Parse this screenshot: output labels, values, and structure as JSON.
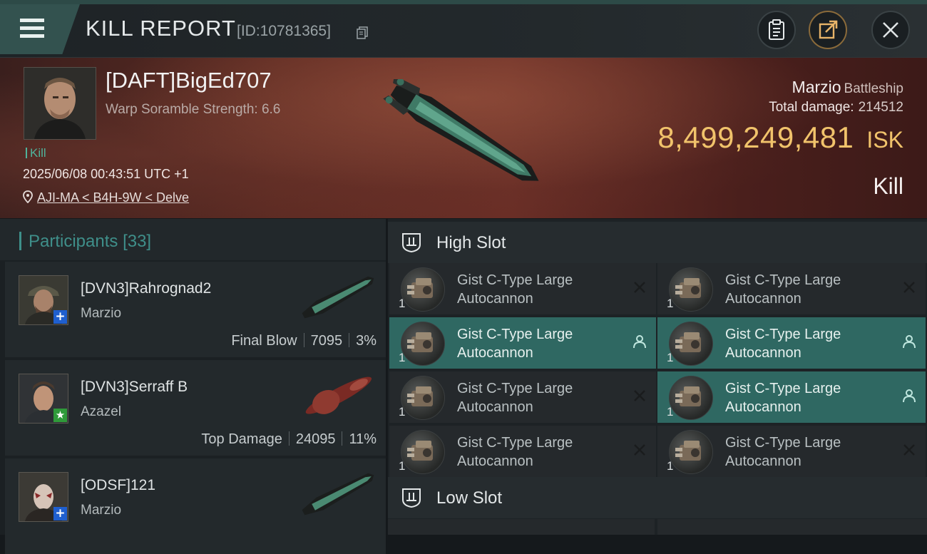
{
  "window": {
    "title": "KILL REPORT",
    "id_label": "[ID:10781365]"
  },
  "victim": {
    "name": "[DAFT]BigEd707",
    "subtitle": "Warp Soramble Strength: 6.6",
    "tag": "Kill",
    "datetime": "2025/06/08 00:43:51 UTC +1",
    "location": "AJI-MA < B4H-9W < Delve",
    "ship_name": "Marzio",
    "ship_class": "Battleship",
    "total_damage_label": "Total damage:",
    "total_damage": "214512",
    "isk_value": "8,499,249,481",
    "isk_unit": "ISK",
    "result": "Kill"
  },
  "participants": {
    "label": "Participants",
    "count": "[33]",
    "rows": [
      {
        "name": "[DVN3]Rahrognad2",
        "ship": "Marzio",
        "stat_label": "Final Blow",
        "damage": "7095",
        "percent": "3%",
        "badge": "+",
        "badge_color": "#1f5fcf"
      },
      {
        "name": "[DVN3]Serraff B",
        "ship": "Azazel",
        "stat_label": "Top Damage",
        "damage": "24095",
        "percent": "11%",
        "badge": "★",
        "badge_color": "#2f9a3a"
      },
      {
        "name": "[ODSF]121",
        "ship": "Marzio",
        "badge": "+",
        "badge_color": "#1f5fcf"
      }
    ]
  },
  "slots": {
    "high_label": "High Slot",
    "low_label": "Low Slot",
    "high_modules": [
      {
        "line1": "Gist C-Type Large",
        "line2": "Autocannon",
        "qty": "1",
        "state": "destroyed"
      },
      {
        "line1": "Gist C-Type Large",
        "line2": "Autocannon",
        "qty": "1",
        "state": "destroyed"
      },
      {
        "line1": "Gist C-Type Large",
        "line2": "Autocannon",
        "qty": "1",
        "state": "dropped"
      },
      {
        "line1": "Gist C-Type Large",
        "line2": "Autocannon",
        "qty": "1",
        "state": "dropped"
      },
      {
        "line1": "Gist C-Type Large",
        "line2": "Autocannon",
        "qty": "1",
        "state": "destroyed"
      },
      {
        "line1": "Gist C-Type Large",
        "line2": "Autocannon",
        "qty": "1",
        "state": "dropped"
      },
      {
        "line1": "Gist C-Type Large",
        "line2": "Autocannon",
        "qty": "1",
        "state": "destroyed"
      },
      {
        "line1": "Gist C-Type Large",
        "line2": "Autocannon",
        "qty": "1",
        "state": "destroyed"
      }
    ]
  },
  "colors": {
    "accent_teal": "#3e8f8a",
    "isk_gold": "#f1c36b",
    "active_module": "#2f6862"
  }
}
